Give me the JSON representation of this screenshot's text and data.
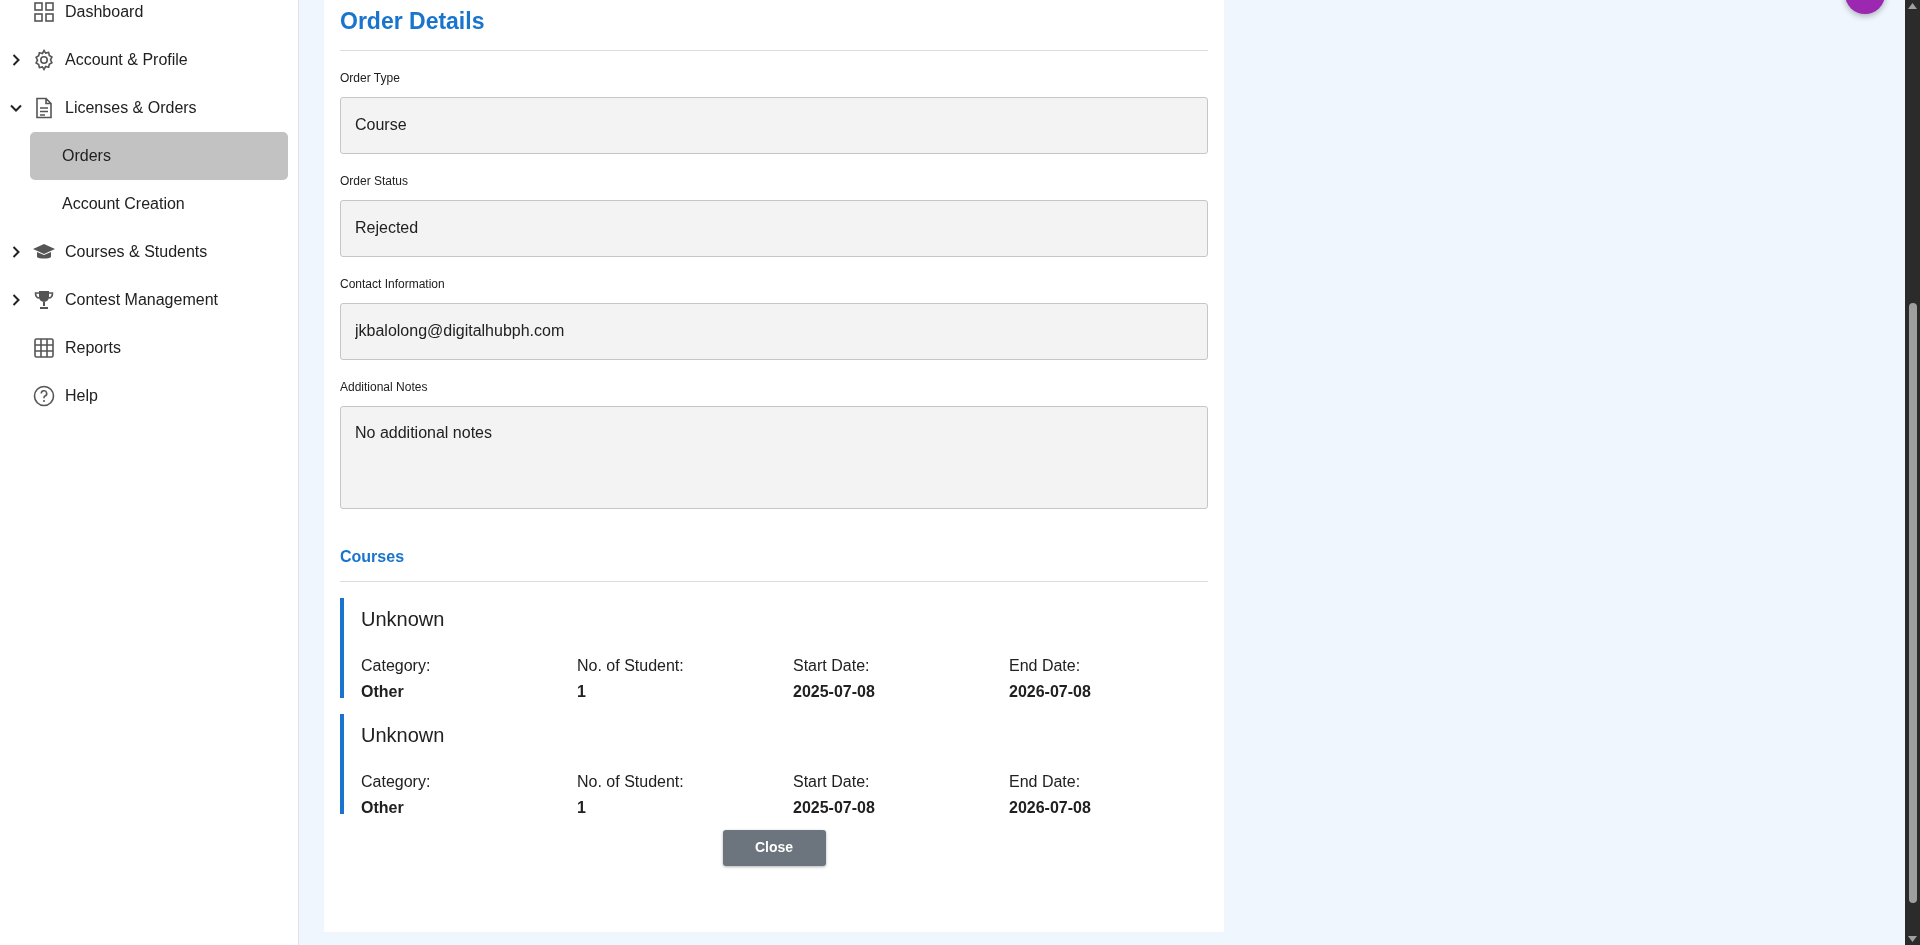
{
  "sidebar": {
    "items": [
      {
        "label": "Dashboard"
      },
      {
        "label": "Account & Profile",
        "expanded": false
      },
      {
        "label": "Licenses & Orders",
        "expanded": true,
        "children": [
          {
            "label": "Orders",
            "selected": true
          },
          {
            "label": "Account Creation",
            "selected": false
          }
        ]
      },
      {
        "label": "Courses & Students",
        "expanded": false
      },
      {
        "label": "Contest Management",
        "expanded": false
      },
      {
        "label": "Reports"
      },
      {
        "label": "Help"
      }
    ]
  },
  "order_details": {
    "title": "Order Details",
    "fields": [
      {
        "label": "Order Type",
        "value": "Course",
        "kind": "input"
      },
      {
        "label": "Order Status",
        "value": "Rejected",
        "kind": "input"
      },
      {
        "label": "Contact Information",
        "value": "jkbalolong@digitalhubph.com",
        "kind": "input"
      },
      {
        "label": "Additional Notes",
        "value": "No additional notes",
        "kind": "textarea"
      }
    ],
    "courses_title": "Courses",
    "courses": [
      {
        "name": "Unknown",
        "details": [
          {
            "label": "Category:",
            "value": "Other"
          },
          {
            "label": "No. of Student:",
            "value": "1"
          },
          {
            "label": "Start Date:",
            "value": "2025-07-08"
          },
          {
            "label": "End Date:",
            "value": "2026-07-08"
          }
        ]
      },
      {
        "name": "Unknown",
        "details": [
          {
            "label": "Category:",
            "value": "Other"
          },
          {
            "label": "No. of Student:",
            "value": "1"
          },
          {
            "label": "Start Date:",
            "value": "2025-07-08"
          },
          {
            "label": "End Date:",
            "value": "2026-07-08"
          }
        ]
      }
    ],
    "close_button": "Close"
  }
}
